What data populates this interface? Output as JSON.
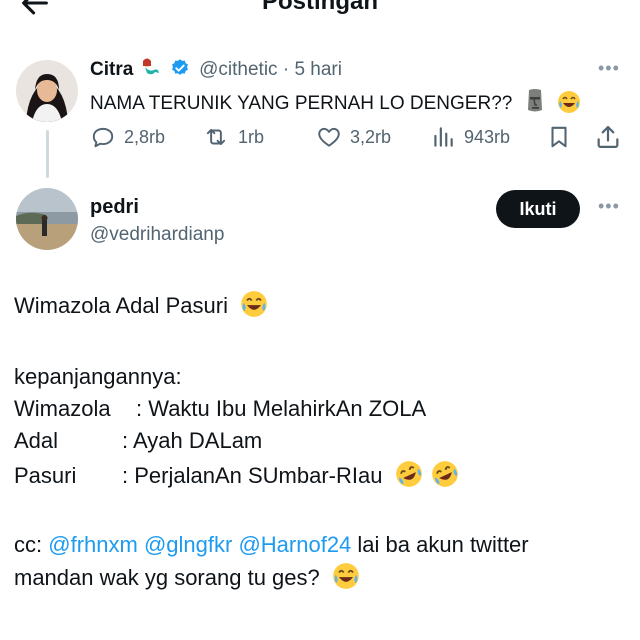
{
  "header": {
    "title": "Postingan",
    "back_icon": "arrow-left-icon"
  },
  "quoted_post": {
    "author_name": "Citra",
    "author_name_emoji": "mermaid-emoji",
    "verified_icon": "verified-badge-icon",
    "handle": "@cithetic",
    "time": "5 hari",
    "separator": "·",
    "text": "NAMA TERUNIK YANG PERNAH LO DENGER??",
    "emojis": [
      "moai-emoji",
      "joy-emoji"
    ],
    "actions": {
      "replies": "2,8rb",
      "retweets": "1rb",
      "likes": "3,2rb",
      "views": "943rb"
    },
    "more_icon": "more-dots-icon"
  },
  "reply_post": {
    "author_name": "pedri",
    "handle": "@vedrihardianp",
    "follow_label": "Ikuti",
    "more_icon": "more-dots-icon",
    "body": {
      "line1": "Wimazola Adal Pasuri",
      "line2": "kepanjangannya:",
      "rows": [
        {
          "term": "Wimazola",
          "sep": ":",
          "meaning": "Waktu Ibu MelahirkAn ZOLA"
        },
        {
          "term": "Adal",
          "sep": ":",
          "meaning": "Ayah DALam"
        },
        {
          "term": "Pasuri",
          "sep": ":",
          "meaning": "PerjalanAn SUmbar-RIau"
        }
      ],
      "cc_prefix": "cc:",
      "mentions": [
        "@frhnxm",
        "@glngfkr",
        "@Harnof24"
      ],
      "cc_suffix": "lai ba akun twitter",
      "last_line": "mandan wak yg sorang tu ges?"
    }
  },
  "colors": {
    "text": "#0f1419",
    "muted": "#536471",
    "link": "#1d9bf0",
    "verified": "#1d9bf0",
    "button": "#0f1419"
  }
}
